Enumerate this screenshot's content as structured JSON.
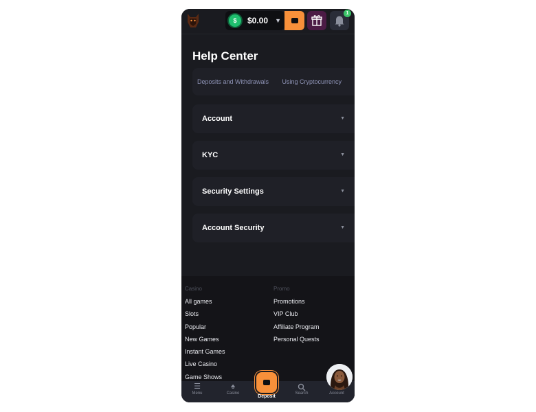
{
  "header": {
    "balance": "$0.00",
    "currency_symbol": "$",
    "notification_count": "1"
  },
  "help_center": {
    "title": "Help Center",
    "categories": [
      {
        "label": "Deposits and Withdrawals"
      },
      {
        "label": "Using Cryptocurrency"
      }
    ],
    "sections": [
      {
        "label": "Account"
      },
      {
        "label": "KYC"
      },
      {
        "label": "Security Settings"
      },
      {
        "label": "Account Security"
      }
    ]
  },
  "footer": {
    "casino": {
      "heading": "Casino",
      "links": [
        "All games",
        "Slots",
        "Popular",
        "New Games",
        "Instant Games",
        "Live Casino",
        "Game Shows"
      ]
    },
    "promo": {
      "heading": "Promo",
      "links": [
        "Promotions",
        "VIP Club",
        "Affiliate Program",
        "Personal Quests"
      ]
    }
  },
  "bottom_nav": {
    "menu": "Menu",
    "casino": "Casino",
    "deposit": "Deposit",
    "search": "Search",
    "account": "Account"
  },
  "colors": {
    "accent_orange": "#f7903a",
    "coin_green": "#1fbf6e",
    "gift_purple": "#4b1b45",
    "background": "#1a1b20",
    "card": "#1f2027"
  },
  "icons": [
    "brand-logo-icon",
    "dollar-coin-icon",
    "chevron-down-icon",
    "wallet-icon",
    "gift-icon",
    "bell-icon",
    "menu-icon",
    "spade-icon",
    "search-icon",
    "user-icon",
    "support-avatar"
  ]
}
